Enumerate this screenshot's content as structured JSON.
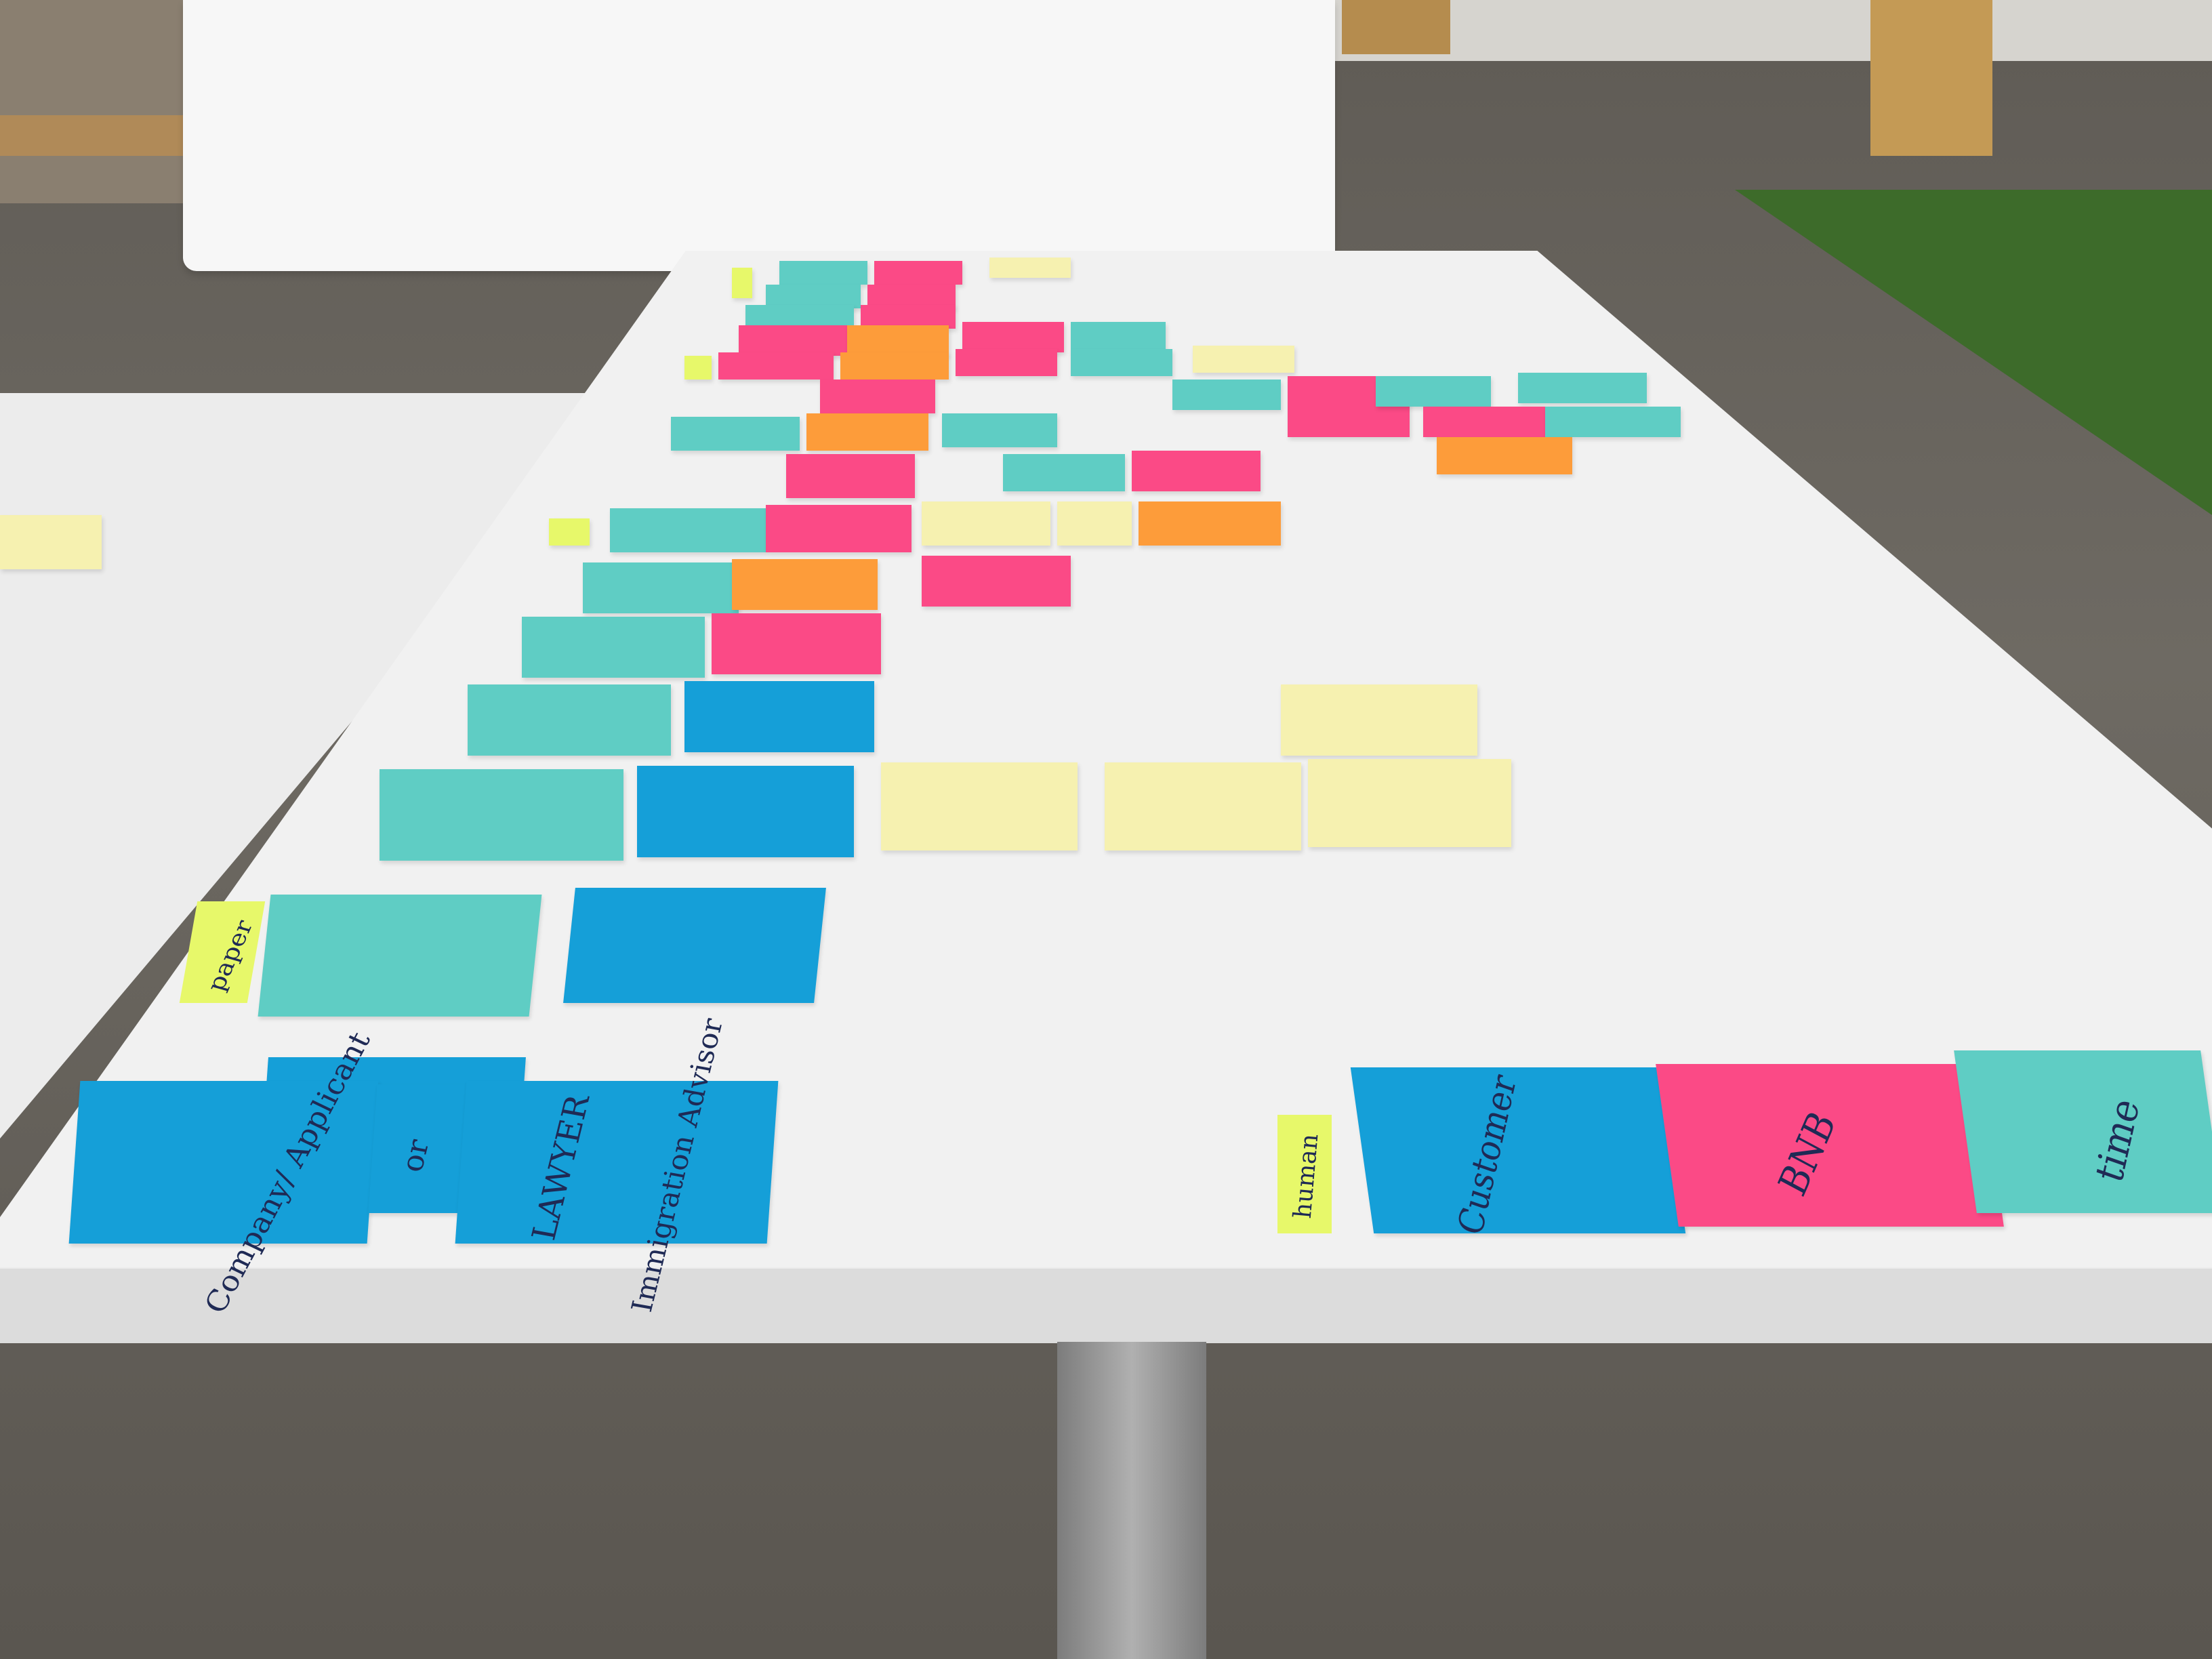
{
  "colors": {
    "floor": "#6b6760",
    "floor_dark": "#55524c",
    "grass": "#3d6b2a",
    "table": "#f1f1f1",
    "table_edge": "#d7d7d7",
    "board": "#f7f7f7",
    "teal": "#5fcdc4",
    "blue": "#159fd8",
    "pink": "#fb4a86",
    "orange": "#fd9c3a",
    "yellow": "#f6f1b0",
    "green_tag": "#e7f86a",
    "leg": "#9a9a9a"
  },
  "tags": {
    "paper": "paper",
    "human": "human"
  },
  "notes": {
    "company_applicant": "Company/ Applicant",
    "or": "or",
    "lawyer": "LAWYER",
    "immigration_advisor": "Immigration Advisor",
    "customer": "Customer",
    "bnb": "BNB",
    "time": "time"
  }
}
